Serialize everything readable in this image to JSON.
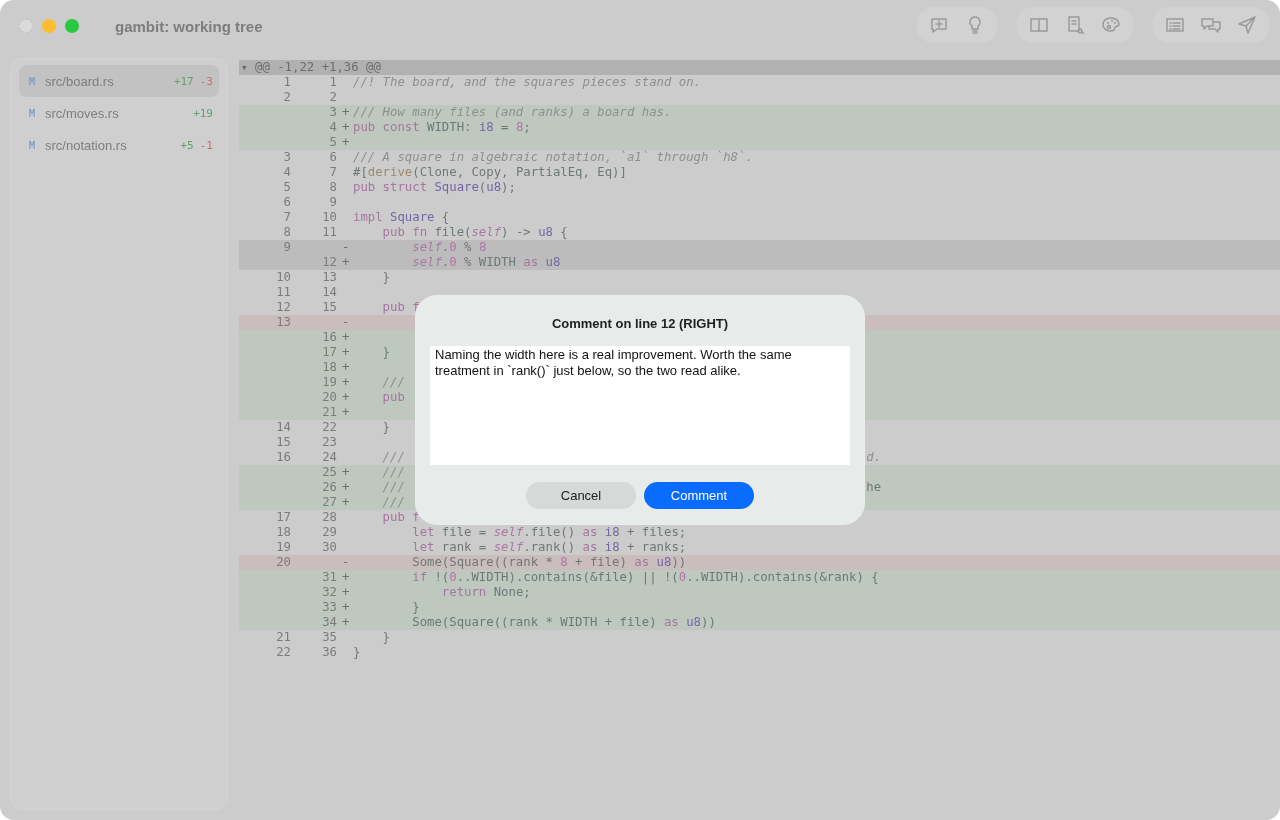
{
  "window": {
    "title": "gambit: working tree",
    "controls": [
      {
        "kind": "close",
        "disabled": true
      },
      {
        "kind": "minimize",
        "disabled": false
      },
      {
        "kind": "zoom",
        "disabled": false
      }
    ]
  },
  "files": [
    {
      "status": "M",
      "path": "src/board.rs",
      "added": "+17",
      "removed": "-3",
      "selected": true
    },
    {
      "status": "M",
      "path": "src/moves.rs",
      "added": "+19",
      "selected": false
    },
    {
      "status": "M",
      "path": "src/notation.rs",
      "added": "+5",
      "removed": "-1",
      "selected": false
    }
  ],
  "diff": {
    "toggle": "▾",
    "hunk": "@@ -1,22 +1,36 @@",
    "lines": [
      {
        "old": "1",
        "new": "1",
        "kind": "ctx",
        "tokens": [
          {
            "kind": "comment",
            "text": "//! The board, and the squares pieces stand on."
          }
        ]
      },
      {
        "old": "2",
        "new": "2",
        "kind": "ctx"
      },
      {
        "new": "3",
        "kind": "add",
        "sign": "+",
        "tokens": [
          {
            "kind": "comment",
            "text": "/// How many files (and ranks) a board has."
          }
        ]
      },
      {
        "new": "4",
        "kind": "add",
        "sign": "+",
        "tokens": [
          {
            "kind": "keyword",
            "text": "pub const "
          },
          {
            "kind": "plain",
            "text": "WIDTH: "
          },
          {
            "kind": "type",
            "text": "i8"
          },
          {
            "kind": "plain",
            "text": " = "
          },
          {
            "kind": "number",
            "text": "8"
          },
          {
            "kind": "plain",
            "text": ";"
          }
        ]
      },
      {
        "new": "5",
        "kind": "add",
        "sign": "+"
      },
      {
        "old": "3",
        "new": "6",
        "kind": "ctx",
        "tokens": [
          {
            "kind": "comment",
            "text": "/// A square in algebraic notation, `a1` through `h8`."
          }
        ]
      },
      {
        "old": "4",
        "new": "7",
        "kind": "ctx",
        "tokens": [
          {
            "kind": "plain",
            "text": "#["
          },
          {
            "kind": "attr",
            "text": "derive"
          },
          {
            "kind": "plain",
            "text": "(Clone, Copy, PartialEq, Eq)]"
          }
        ]
      },
      {
        "old": "5",
        "new": "8",
        "kind": "ctx",
        "tokens": [
          {
            "kind": "keyword",
            "text": "pub struct "
          },
          {
            "kind": "type",
            "text": "Square"
          },
          {
            "kind": "plain",
            "text": "("
          },
          {
            "kind": "type",
            "text": "u8"
          },
          {
            "kind": "plain",
            "text": ");"
          }
        ]
      },
      {
        "old": "6",
        "new": "9",
        "kind": "ctx"
      },
      {
        "old": "7",
        "new": "10",
        "kind": "ctx",
        "tokens": [
          {
            "kind": "keyword",
            "text": "impl "
          },
          {
            "kind": "type",
            "text": "Square"
          },
          {
            "kind": "plain",
            "text": " {"
          }
        ]
      },
      {
        "old": "8",
        "new": "11",
        "kind": "ctx",
        "tokens": [
          {
            "kind": "keyword",
            "text": "    pub fn "
          },
          {
            "kind": "plain",
            "text": "file("
          },
          {
            "kind": "self",
            "text": "self"
          },
          {
            "kind": "plain",
            "text": ") -> "
          },
          {
            "kind": "type",
            "text": "u8"
          },
          {
            "kind": "plain",
            "text": " {"
          }
        ]
      },
      {
        "old": "9",
        "kind": "del",
        "sign": "-",
        "selected": true,
        "tokens": [
          {
            "kind": "self",
            "text": "        self"
          },
          {
            "kind": "plain",
            "text": "."
          },
          {
            "kind": "number",
            "text": "0"
          },
          {
            "kind": "plain",
            "text": " % "
          },
          {
            "kind": "number",
            "text": "8"
          }
        ]
      },
      {
        "new": "12",
        "kind": "add",
        "sign": "+",
        "selected": true,
        "tokens": [
          {
            "kind": "self",
            "text": "        self"
          },
          {
            "kind": "plain",
            "text": "."
          },
          {
            "kind": "number",
            "text": "0"
          },
          {
            "kind": "plain",
            "text": " % WIDTH "
          },
          {
            "kind": "keyword",
            "text": "as "
          },
          {
            "kind": "type",
            "text": "u8"
          }
        ]
      },
      {
        "old": "10",
        "new": "13",
        "kind": "ctx",
        "tokens": [
          {
            "kind": "plain",
            "text": "    }"
          }
        ]
      },
      {
        "old": "11",
        "new": "14",
        "kind": "ctx"
      },
      {
        "old": "12",
        "new": "15",
        "kind": "ctx",
        "tokens": [
          {
            "kind": "keyword",
            "text": "    pub f"
          }
        ]
      },
      {
        "old": "13",
        "kind": "del",
        "sign": "-"
      },
      {
        "new": "16",
        "kind": "add",
        "sign": "+"
      },
      {
        "new": "17",
        "kind": "add",
        "sign": "+",
        "tokens": [
          {
            "kind": "plain",
            "text": "    }"
          }
        ]
      },
      {
        "new": "18",
        "kind": "add",
        "sign": "+"
      },
      {
        "new": "19",
        "kind": "add",
        "sign": "+",
        "tokens": [
          {
            "kind": "comment",
            "text": "    ///"
          }
        ]
      },
      {
        "new": "20",
        "kind": "add",
        "sign": "+",
        "tokens": [
          {
            "kind": "keyword",
            "text": "    pub"
          }
        ]
      },
      {
        "new": "21",
        "kind": "add",
        "sign": "+"
      },
      {
        "old": "14",
        "new": "22",
        "kind": "ctx",
        "tokens": [
          {
            "kind": "plain",
            "text": "    }"
          }
        ]
      },
      {
        "old": "15",
        "new": "23",
        "kind": "ctx"
      },
      {
        "old": "16",
        "new": "24",
        "kind": "ctx",
        "tokens": [
          {
            "kind": "comment",
            "text": "    ///"
          }
        ],
        "tail": [
          {
            "kind": "comment",
            "text": "d."
          }
        ]
      },
      {
        "new": "25",
        "kind": "add",
        "sign": "+",
        "tokens": [
          {
            "kind": "comment",
            "text": "    ///"
          }
        ]
      },
      {
        "new": "26",
        "kind": "add",
        "sign": "+",
        "tokens": [
          {
            "kind": "comment",
            "text": "    ///"
          }
        ],
        "tail": [
          {
            "kind": "plain",
            "text": "he"
          }
        ]
      },
      {
        "new": "27",
        "kind": "add",
        "sign": "+",
        "tokens": [
          {
            "kind": "comment",
            "text": "    ///"
          }
        ]
      },
      {
        "old": "17",
        "new": "28",
        "kind": "ctx",
        "tokens": [
          {
            "kind": "keyword",
            "text": "    pub f"
          }
        ]
      },
      {
        "old": "18",
        "new": "29",
        "kind": "ctx",
        "tokens": [
          {
            "kind": "keyword",
            "text": "        let "
          },
          {
            "kind": "plain",
            "text": "file = "
          },
          {
            "kind": "self",
            "text": "self"
          },
          {
            "kind": "plain",
            "text": ".file() "
          },
          {
            "kind": "keyword",
            "text": "as "
          },
          {
            "kind": "type",
            "text": "i8"
          },
          {
            "kind": "plain",
            "text": " + files;"
          }
        ]
      },
      {
        "old": "19",
        "new": "30",
        "kind": "ctx",
        "tokens": [
          {
            "kind": "keyword",
            "text": "        let "
          },
          {
            "kind": "plain",
            "text": "rank = "
          },
          {
            "kind": "self",
            "text": "self"
          },
          {
            "kind": "plain",
            "text": ".rank() "
          },
          {
            "kind": "keyword",
            "text": "as "
          },
          {
            "kind": "type",
            "text": "i8"
          },
          {
            "kind": "plain",
            "text": " + ranks;"
          }
        ]
      },
      {
        "old": "20",
        "kind": "del",
        "sign": "-",
        "tokens": [
          {
            "kind": "plain",
            "text": "        Some(Square((rank * "
          },
          {
            "kind": "number",
            "text": "8"
          },
          {
            "kind": "plain",
            "text": " + file) "
          },
          {
            "kind": "keyword",
            "text": "as "
          },
          {
            "kind": "type",
            "text": "u8"
          },
          {
            "kind": "plain",
            "text": "))"
          }
        ]
      },
      {
        "new": "31",
        "kind": "add",
        "sign": "+",
        "tokens": [
          {
            "kind": "keyword",
            "text": "        if "
          },
          {
            "kind": "plain",
            "text": "!("
          },
          {
            "kind": "number",
            "text": "0"
          },
          {
            "kind": "plain",
            "text": "..WIDTH).contains(&file) || !("
          },
          {
            "kind": "number",
            "text": "0"
          },
          {
            "kind": "plain",
            "text": "..WIDTH).contains(&rank) {"
          }
        ]
      },
      {
        "new": "32",
        "kind": "add",
        "sign": "+",
        "tokens": [
          {
            "kind": "keyword",
            "text": "            return "
          },
          {
            "kind": "plain",
            "text": "None;"
          }
        ]
      },
      {
        "new": "33",
        "kind": "add",
        "sign": "+",
        "tokens": [
          {
            "kind": "plain",
            "text": "        }"
          }
        ]
      },
      {
        "new": "34",
        "kind": "add",
        "sign": "+",
        "tokens": [
          {
            "kind": "plain",
            "text": "        Some(Square((rank * WIDTH + file) "
          },
          {
            "kind": "keyword",
            "text": "as "
          },
          {
            "kind": "type",
            "text": "u8"
          },
          {
            "kind": "plain",
            "text": "))"
          }
        ]
      },
      {
        "old": "21",
        "new": "35",
        "kind": "ctx",
        "tokens": [
          {
            "kind": "plain",
            "text": "    }"
          }
        ]
      },
      {
        "old": "22",
        "new": "36",
        "kind": "ctx",
        "tokens": [
          {
            "kind": "plain",
            "text": "}"
          }
        ]
      }
    ]
  },
  "dialog": {
    "title": "Comment on line 12 (RIGHT)",
    "value": "Naming the width here is a real improvement. Worth the same treatment in `rank()` just below, so the two read alike.",
    "buttons": [
      {
        "label": "Cancel",
        "kind": "secondary"
      },
      {
        "label": "Comment",
        "kind": "primary"
      }
    ]
  }
}
